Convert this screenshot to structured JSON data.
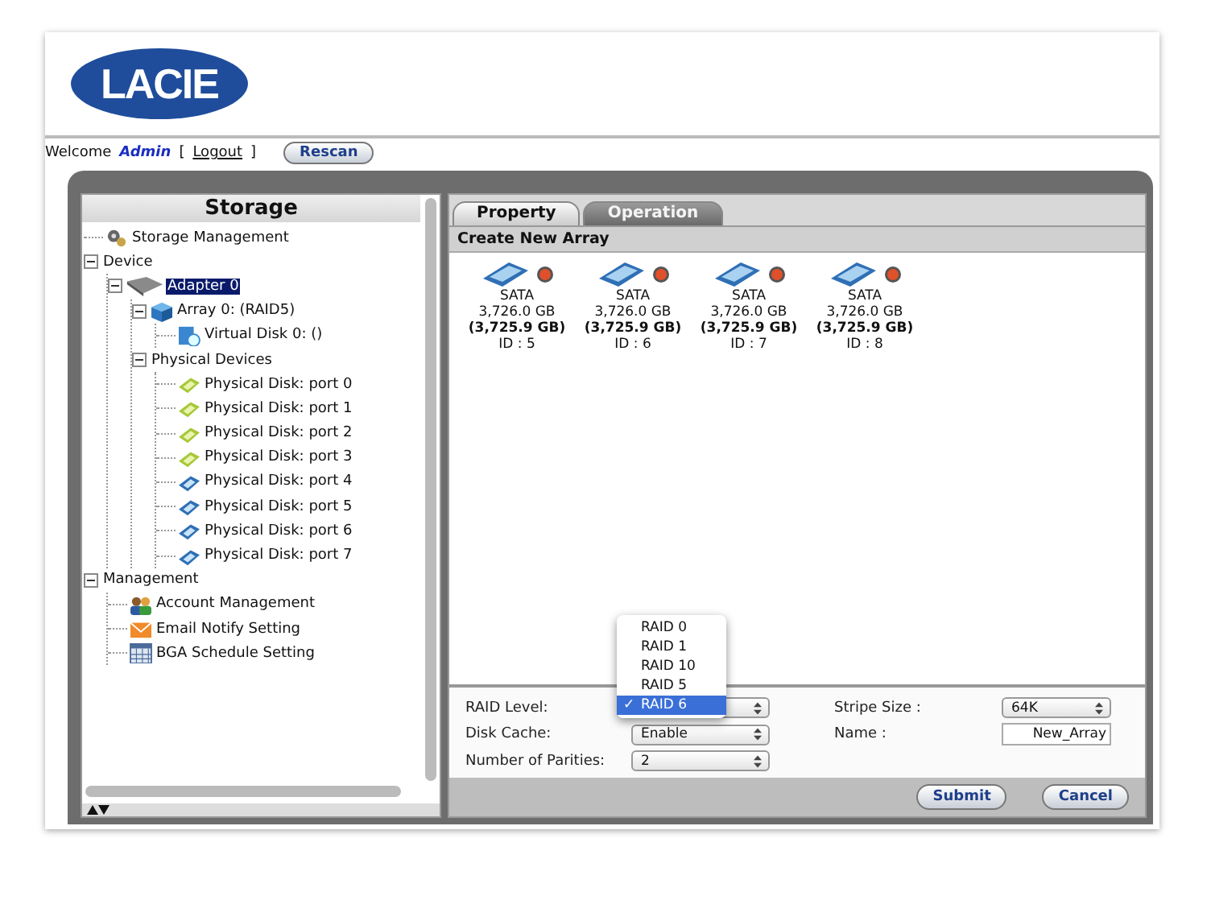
{
  "header": {
    "logo": "LACIE"
  },
  "user_bar": {
    "welcome": "Welcome",
    "user": "Admin",
    "logout_open": "[",
    "logout": "Logout",
    "logout_close": "]",
    "rescan": "Rescan"
  },
  "sidebar": {
    "title": "Storage",
    "tree": [
      {
        "label": "Storage Management",
        "kind": "storage",
        "selected": false
      },
      {
        "label": "Device",
        "kind": "group",
        "expanded": true,
        "selected": false,
        "children": [
          {
            "label": "Adapter 0",
            "kind": "adapter",
            "expanded": true,
            "selected": true,
            "children": [
              {
                "label": "Array 0: (RAID5)",
                "kind": "array",
                "expanded": true,
                "selected": false,
                "children": [
                  {
                    "label": "Virtual Disk 0: ()",
                    "kind": "virtual",
                    "selected": false
                  }
                ]
              },
              {
                "label": "Physical Devices",
                "kind": "group",
                "expanded": true,
                "selected": false,
                "children": [
                  {
                    "label": "Physical Disk: port 0",
                    "kind": "free-disk",
                    "selected": false
                  },
                  {
                    "label": "Physical Disk: port 1",
                    "kind": "free-disk",
                    "selected": false
                  },
                  {
                    "label": "Physical Disk: port 2",
                    "kind": "free-disk",
                    "selected": false
                  },
                  {
                    "label": "Physical Disk: port 3",
                    "kind": "free-disk",
                    "selected": false
                  },
                  {
                    "label": "Physical Disk: port 4",
                    "kind": "array-disk",
                    "selected": false
                  },
                  {
                    "label": "Physical Disk: port 5",
                    "kind": "array-disk",
                    "selected": false
                  },
                  {
                    "label": "Physical Disk: port 6",
                    "kind": "array-disk",
                    "selected": false
                  },
                  {
                    "label": "Physical Disk: port 7",
                    "kind": "array-disk",
                    "selected": false
                  }
                ]
              }
            ]
          }
        ]
      },
      {
        "label": "Management",
        "kind": "group",
        "expanded": true,
        "selected": false,
        "children": [
          {
            "label": "Account Management",
            "kind": "account",
            "selected": false
          },
          {
            "label": "Email Notify Setting",
            "kind": "email",
            "selected": false
          },
          {
            "label": "BGA Schedule Setting",
            "kind": "schedule",
            "selected": false
          }
        ]
      }
    ]
  },
  "tabs": [
    {
      "label": "Property",
      "selected": false
    },
    {
      "label": "Operation",
      "selected": true
    }
  ],
  "section_title": "Create New Array",
  "disks": [
    {
      "type": "SATA",
      "size": "3,726.0 GB",
      "usable": "(3,725.9 GB)",
      "id": "ID : 5"
    },
    {
      "type": "SATA",
      "size": "3,726.0 GB",
      "usable": "(3,725.9 GB)",
      "id": "ID : 6"
    },
    {
      "type": "SATA",
      "size": "3,726.0 GB",
      "usable": "(3,725.9 GB)",
      "id": "ID : 7"
    },
    {
      "type": "SATA",
      "size": "3,726.0 GB",
      "usable": "(3,725.9 GB)",
      "id": "ID : 8"
    }
  ],
  "form": {
    "left_fields": [
      {
        "label": "RAID Level:",
        "kind": "select"
      },
      {
        "label": "Disk Cache:",
        "kind": "select",
        "value": "Enable"
      },
      {
        "label": "Number of Parities:",
        "kind": "select",
        "value": "2"
      }
    ],
    "right_fields": [
      {
        "label": "Stripe Size :",
        "kind": "select",
        "value": "64K"
      },
      {
        "label": "Name :",
        "kind": "text",
        "value": "New_Array"
      }
    ],
    "raid_menu": [
      {
        "label": "RAID 0",
        "selected": false
      },
      {
        "label": "RAID 1",
        "selected": false
      },
      {
        "label": "RAID 10",
        "selected": false
      },
      {
        "label": "RAID 5",
        "selected": false
      },
      {
        "label": "RAID 6",
        "selected": true
      }
    ],
    "check_mark": "✓"
  },
  "buttons": [
    "Submit",
    "Cancel"
  ]
}
